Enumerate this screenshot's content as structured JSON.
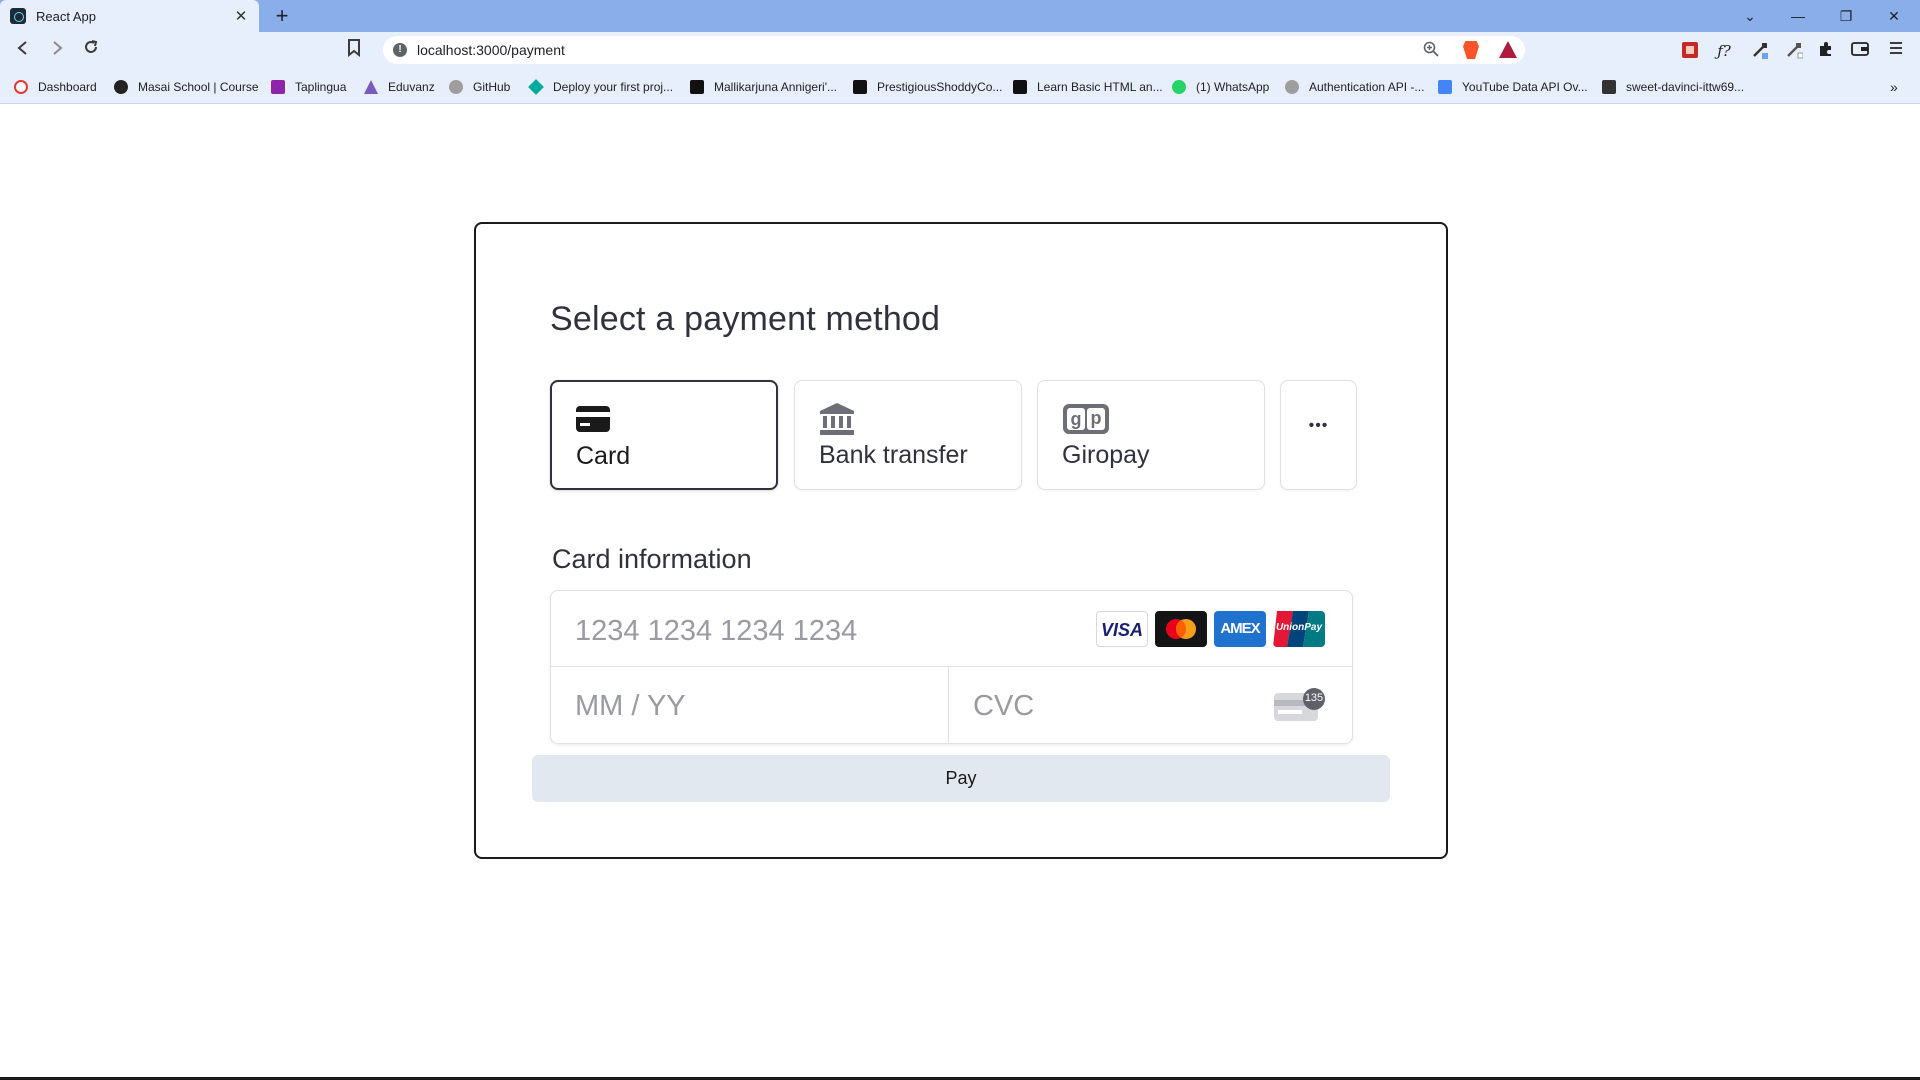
{
  "browser": {
    "tab_title": "React App",
    "tab_close": "✕",
    "new_tab": "+",
    "url": "localhost:3000/payment",
    "window_controls": [
      "⌄",
      "—",
      "❐",
      "✕"
    ],
    "bookmarks": [
      {
        "label": "Dashboard",
        "color": "#e53935"
      },
      {
        "label": "Masai School | Course",
        "color": "#222222"
      },
      {
        "label": "Taplingua",
        "color": "#8e24aa"
      },
      {
        "label": "Eduvanz",
        "color": "#7a5bbd"
      },
      {
        "label": "GitHub",
        "color": "#9e9e9e"
      },
      {
        "label": "Deploy your first proj...",
        "color": "#00ad9f"
      },
      {
        "label": "Mallikarjuna Annigeri'...",
        "color": "#111111"
      },
      {
        "label": "PrestigiousShoddyCo...",
        "color": "#111111"
      },
      {
        "label": "Learn Basic HTML an...",
        "color": "#111111"
      },
      {
        "label": "(1) WhatsApp",
        "color": "#25d366"
      },
      {
        "label": "Authentication API -...",
        "color": "#9e9e9e"
      },
      {
        "label": "YouTube Data API Ov...",
        "color": "#4285f4"
      },
      {
        "label": "sweet-davinci-ittw69...",
        "color": "#333333"
      }
    ],
    "more_bookmarks": "»"
  },
  "payment": {
    "title": "Select a payment method",
    "methods": [
      {
        "label": "Card",
        "icon": "card-icon",
        "selected": true
      },
      {
        "label": "Bank transfer",
        "icon": "bank-icon",
        "selected": false
      },
      {
        "label": "Giropay",
        "icon": "giropay-icon",
        "selected": false
      }
    ],
    "more_methods": "•••",
    "card_info_label": "Card information",
    "card_number_placeholder": "1234 1234 1234 1234",
    "expiry_placeholder": "MM / YY",
    "cvc_placeholder": "CVC",
    "cvc_badge": "135",
    "brands": [
      "VISA",
      "mastercard",
      "AMEX",
      "UnionPay"
    ],
    "pay_label": "Pay"
  },
  "accent_colors": {
    "tab_strip": "#8aaeea",
    "toolbar": "#e8effc",
    "pay_button": "#e2e8f0",
    "text": "#30313d"
  }
}
